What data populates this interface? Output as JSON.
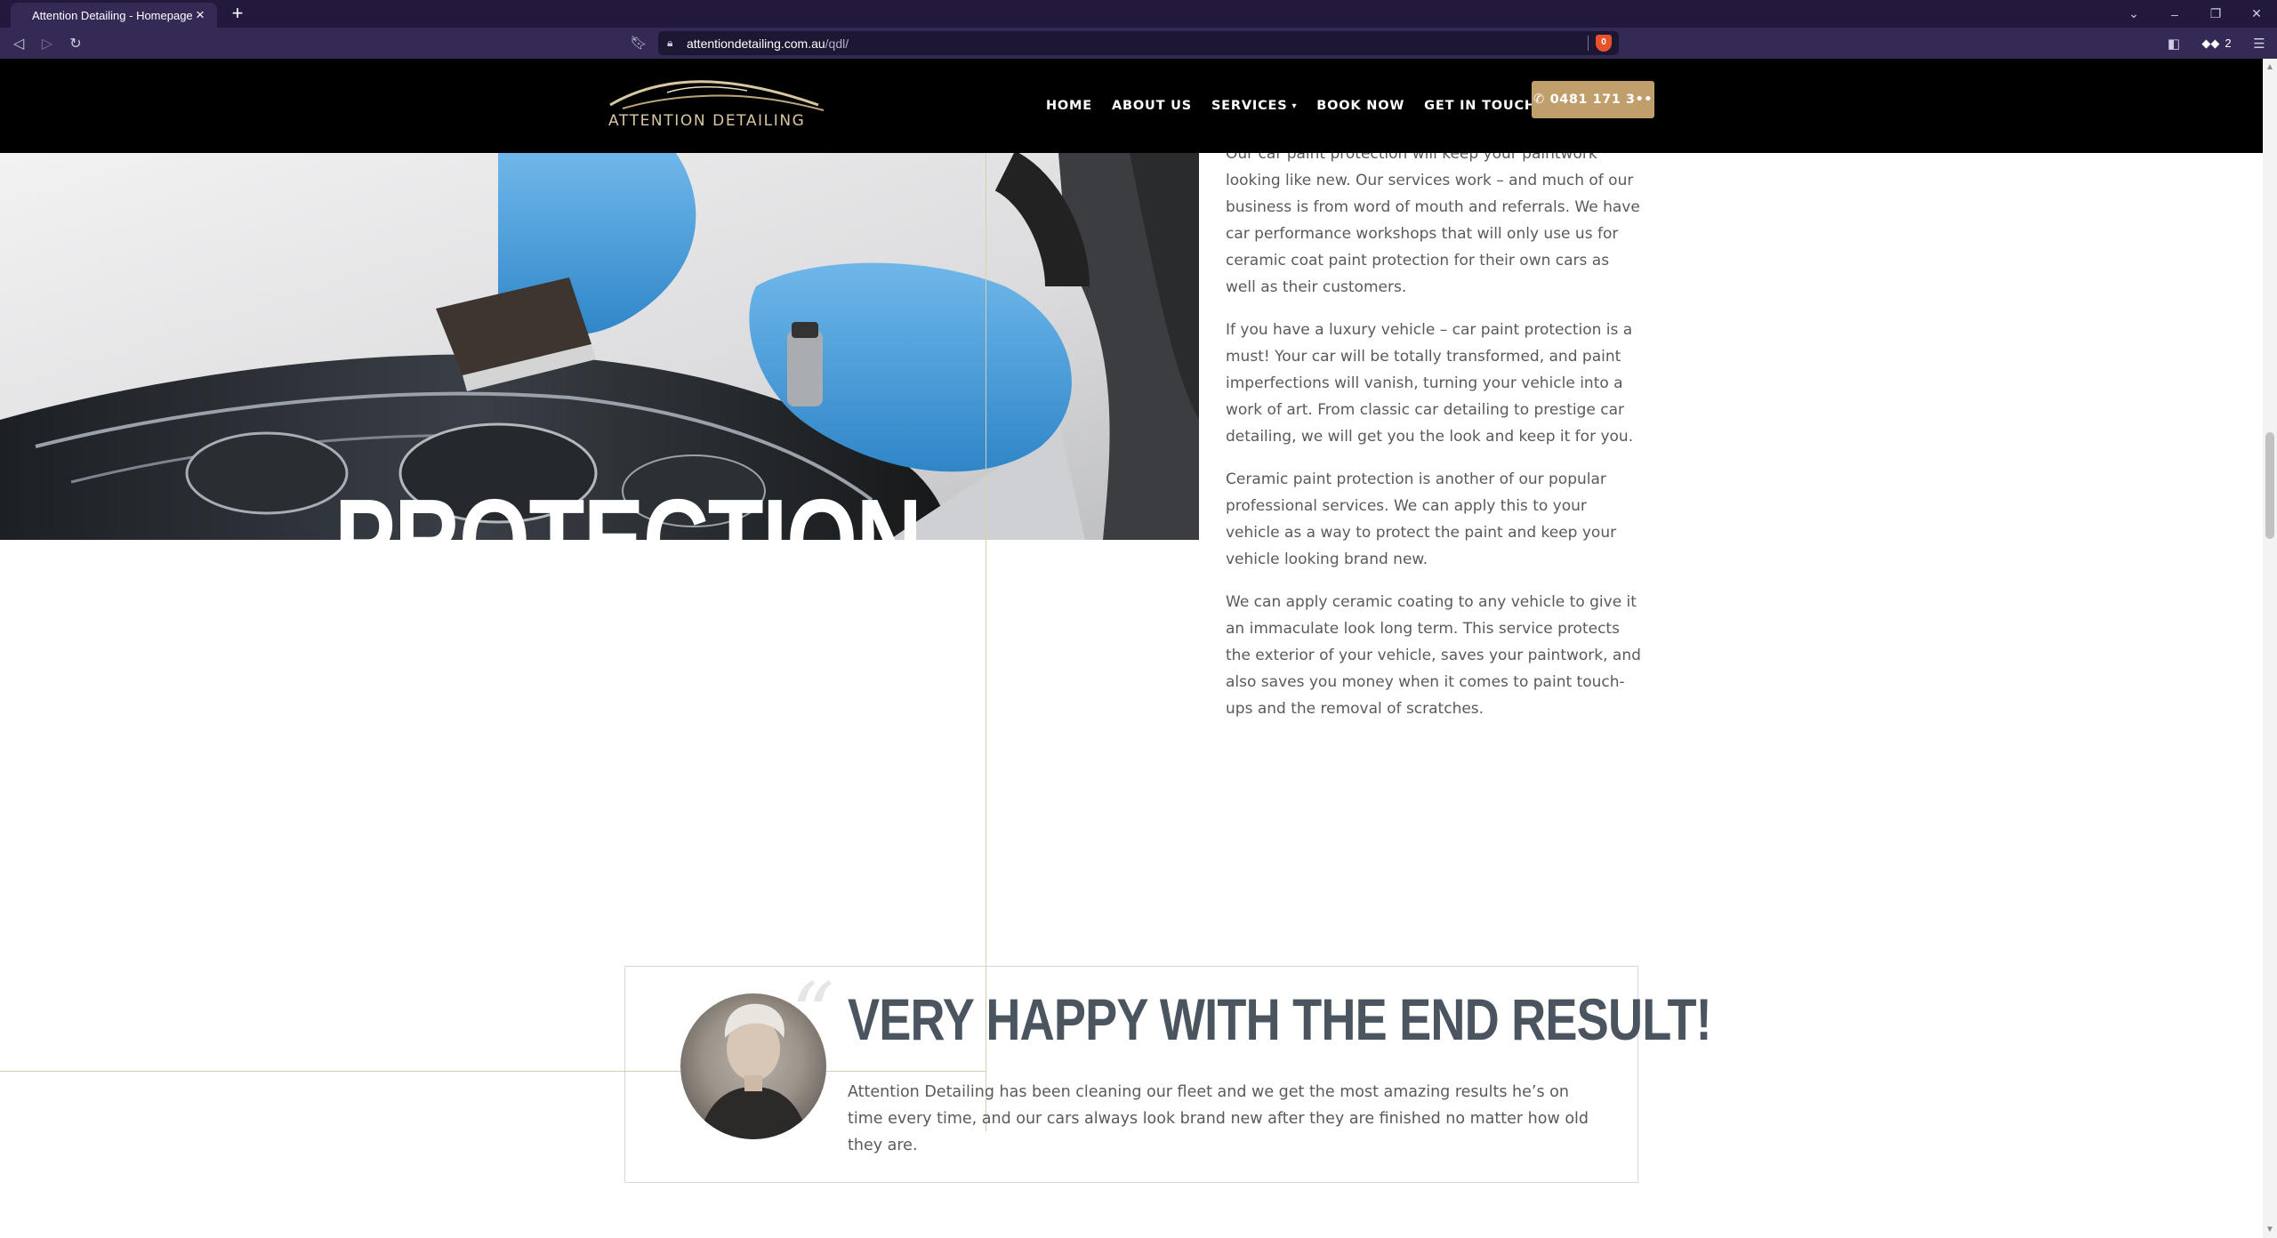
{
  "browser": {
    "tab_title": "Attention Detailing - Homepage",
    "url_host": "attentiondetailing.com.au",
    "url_path": "/qdl/",
    "wallet_count": "2",
    "shield_badge": "0"
  },
  "site": {
    "logo_text": "ATTENTION DETAILING",
    "menu": [
      {
        "label": "HOME"
      },
      {
        "label": "ABOUT US"
      },
      {
        "label": "SERVICES"
      },
      {
        "label": "BOOK NOW"
      },
      {
        "label": "GET IN TOUCH"
      }
    ],
    "phone_label": "0481 171 3••",
    "accent_color": "#c09f6c"
  },
  "hero": {
    "overlay_word": "PROTECTION"
  },
  "copy": {
    "paragraphs": [
      "Our car paint protection will keep your paintwork looking like new. Our services work – and much of our business is from word of mouth and referrals. We have car performance workshops that will only use us for ceramic coat paint protection for their own cars as well as their customers.",
      "If you have a luxury vehicle – car paint protection is a must! Your car will be totally transformed, and paint imperfections will vanish, turning your vehicle into a work of art. From classic car detailing to prestige car detailing, we will get you the look and keep it for you.",
      "Ceramic paint protection is another of our popular professional services. We can apply this to your vehicle as a way to protect the paint and keep your vehicle looking brand new.",
      "We can apply ceramic coating to any vehicle to give it an immaculate look long term. This service protects the exterior of your vehicle, saves your paintwork, and also saves you money when it comes to paint touch-ups and the removal of scratches."
    ]
  },
  "testimonial": {
    "title": "VERY HAPPY WITH THE END RESULT!",
    "body": "Attention Detailing has been cleaning our fleet and we get the most amazing results he’s on time every time, and our cars always look brand new after they are finished no matter how old they are.",
    "quote_glyph": "“"
  }
}
